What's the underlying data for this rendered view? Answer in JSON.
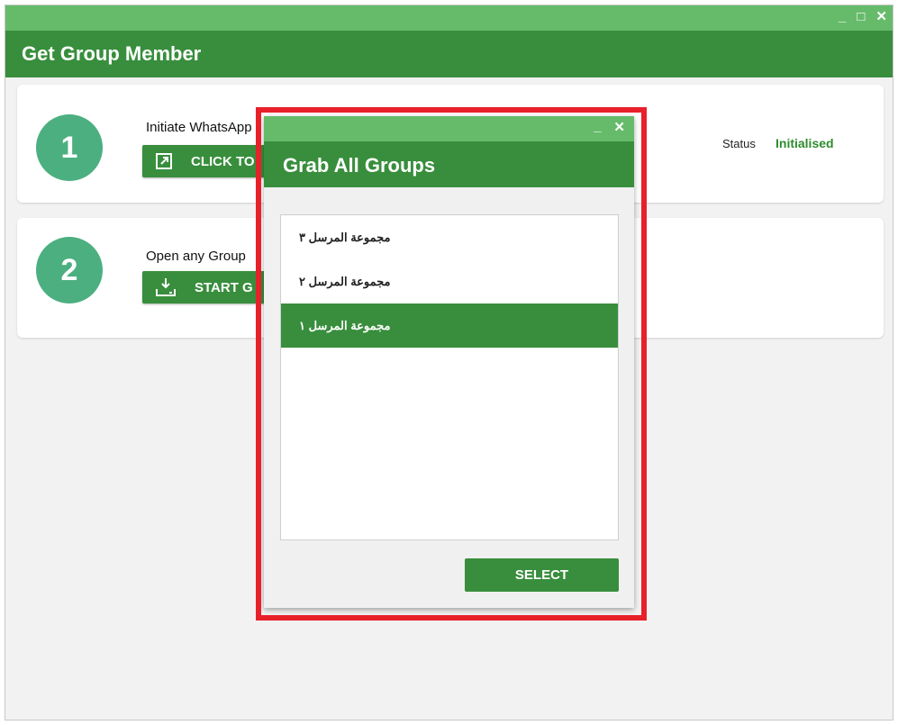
{
  "window": {
    "title": "Get Group Member",
    "minimize_label": "_",
    "maximize_label": "□",
    "close_label": "✕"
  },
  "steps": [
    {
      "number": "1",
      "label": "Initiate WhatsApp",
      "button_label": "CLICK TO",
      "button_icon": "external-link-icon"
    },
    {
      "number": "2",
      "label": "Open any Group",
      "button_label": "START G",
      "button_icon": "download-tray-icon"
    }
  ],
  "status": {
    "label": "Status",
    "value": "Initialised",
    "value_color": "#2e8b2e"
  },
  "dialog": {
    "title": "Grab All Groups",
    "minimize_label": "_",
    "close_label": "✕",
    "groups": [
      {
        "name": "مجموعة المرسل ٣",
        "selected": false
      },
      {
        "name": "مجموعة المرسل ٢",
        "selected": false
      },
      {
        "name": "مجموعة المرسل ١",
        "selected": true
      }
    ],
    "select_label": "SELECT"
  },
  "colors": {
    "titlebar": "#66bb6a",
    "header": "#388e3c",
    "step_circle": "#4caf80",
    "highlight_border": "#e8202a"
  }
}
